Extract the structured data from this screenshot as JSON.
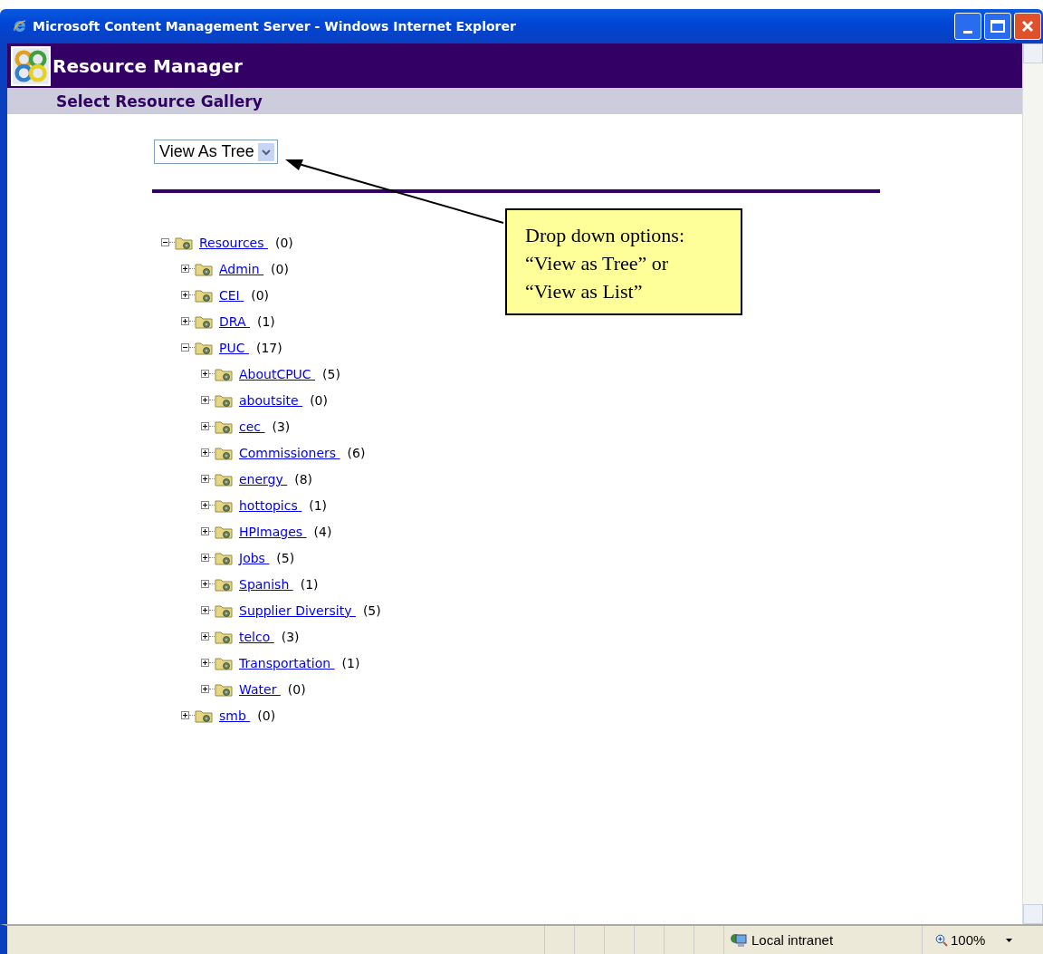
{
  "window": {
    "title": "Microsoft Content Management Server - Windows Internet Explorer"
  },
  "header": {
    "title": "Resource Manager",
    "subtitle": "Select Resource Gallery"
  },
  "view_select": {
    "value": "View As Tree"
  },
  "tree": [
    {
      "name": "Resources",
      "count": "(0)",
      "expanded": true,
      "children": [
        {
          "name": "Admin",
          "count": "(0)",
          "expanded": false
        },
        {
          "name": "CEI",
          "count": "(0)",
          "expanded": false
        },
        {
          "name": "DRA",
          "count": "(1)",
          "expanded": false
        },
        {
          "name": "PUC",
          "count": "(17)",
          "expanded": true,
          "children": [
            {
              "name": "AboutCPUC",
              "count": "(5)",
              "expanded": false
            },
            {
              "name": "aboutsite",
              "count": "(0)",
              "expanded": false
            },
            {
              "name": "cec",
              "count": "(3)",
              "expanded": false
            },
            {
              "name": "Commissioners",
              "count": "(6)",
              "expanded": false
            },
            {
              "name": "energy",
              "count": "(8)",
              "expanded": false
            },
            {
              "name": "hottopics",
              "count": "(1)",
              "expanded": false
            },
            {
              "name": "HPImages",
              "count": "(4)",
              "expanded": false
            },
            {
              "name": "Jobs",
              "count": "(5)",
              "expanded": false
            },
            {
              "name": "Spanish",
              "count": "(1)",
              "expanded": false
            },
            {
              "name": "Supplier Diversity",
              "count": "(5)",
              "expanded": false
            },
            {
              "name": "telco",
              "count": "(3)",
              "expanded": false
            },
            {
              "name": "Transportation",
              "count": "(1)",
              "expanded": false
            },
            {
              "name": "Water",
              "count": "(0)",
              "expanded": false
            }
          ]
        },
        {
          "name": "smb",
          "count": "(0)",
          "expanded": false
        }
      ]
    }
  ],
  "callout": {
    "text": "Drop down options:\n“View as Tree” or\n“View as List”"
  },
  "status_bar": {
    "zone": "Local intranet",
    "zoom": "100%"
  }
}
